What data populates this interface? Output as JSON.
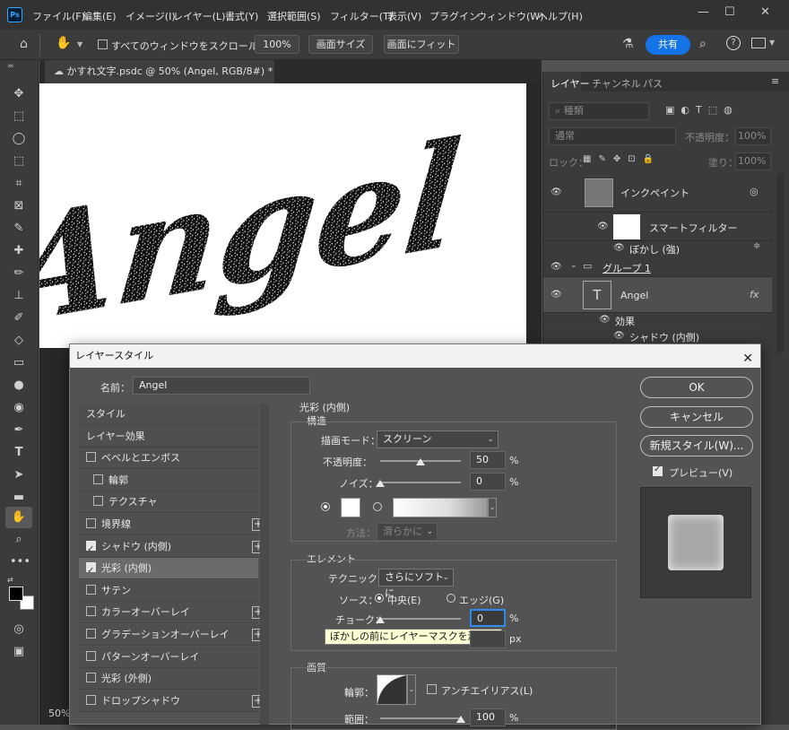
{
  "app": {
    "logo": "Ps",
    "menu": [
      "ファイル(F)",
      "編集(E)",
      "イメージ(I)",
      "レイヤー(L)",
      "書式(Y)",
      "選択範囲(S)",
      "フィルター(T)",
      "表示(V)",
      "プラグイン",
      "ウィンドウ(W)",
      "ヘルプ(H)"
    ]
  },
  "options_bar": {
    "scroll_all_label": "すべてのウィンドウをスクロール",
    "zoom_value": "100%",
    "fit_screen_label": "画面サイズ",
    "fill_screen_label": "画面にフィット",
    "share_label": "共有"
  },
  "document": {
    "tab_title": "かすれ文字.psdc @ 50% (Angel, RGB/8#) *",
    "canvas_text": "Angel",
    "zoom_status": "50%"
  },
  "layers_panel": {
    "tabs": [
      "レイヤー",
      "チャンネル",
      "パス"
    ],
    "filter_placeholder": "種類",
    "blend_mode": "通常",
    "opacity_label": "不透明度：",
    "opacity_value": "100%",
    "lock_label": "ロック：",
    "fill_label": "塗り：",
    "fill_value": "100%",
    "layers": {
      "inpaint": "インクペイント",
      "smart_filter": "スマートフィルター",
      "blur": "ぼかし (強)",
      "group": "グループ 1",
      "angel": "Angel",
      "effects": "効果",
      "inner_shadow": "シャドウ (内側)",
      "text_thumb": "T",
      "fx": "fx"
    }
  },
  "dialog": {
    "title": "レイヤースタイル",
    "name_label": "名前：",
    "name_value": "Angel",
    "styles": [
      {
        "label": "スタイル",
        "checkbox": false,
        "checked": false,
        "plus": false,
        "selected": false
      },
      {
        "label": "レイヤー効果",
        "checkbox": false,
        "checked": false,
        "plus": false,
        "selected": false
      },
      {
        "label": "ベベルとエンボス",
        "checkbox": true,
        "checked": false,
        "plus": false,
        "selected": false
      },
      {
        "label": "輪郭",
        "checkbox": true,
        "checked": false,
        "plus": false,
        "selected": false,
        "indent": true
      },
      {
        "label": "テクスチャ",
        "checkbox": true,
        "checked": false,
        "plus": false,
        "selected": false,
        "indent": true
      },
      {
        "label": "境界線",
        "checkbox": true,
        "checked": false,
        "plus": true,
        "selected": false
      },
      {
        "label": "シャドウ (内側)",
        "checkbox": true,
        "checked": true,
        "plus": true,
        "selected": false
      },
      {
        "label": "光彩 (内側)",
        "checkbox": true,
        "checked": true,
        "plus": false,
        "selected": true
      },
      {
        "label": "サテン",
        "checkbox": true,
        "checked": false,
        "plus": false,
        "selected": false
      },
      {
        "label": "カラーオーバーレイ",
        "checkbox": true,
        "checked": false,
        "plus": true,
        "selected": false
      },
      {
        "label": "グラデーションオーバーレイ",
        "checkbox": true,
        "checked": false,
        "plus": true,
        "selected": false
      },
      {
        "label": "パターンオーバーレイ",
        "checkbox": true,
        "checked": false,
        "plus": false,
        "selected": false
      },
      {
        "label": "光彩 (外側)",
        "checkbox": true,
        "checked": false,
        "plus": false,
        "selected": false
      },
      {
        "label": "ドロップシャドウ",
        "checkbox": true,
        "checked": false,
        "plus": true,
        "selected": false
      }
    ],
    "section_title": "光彩 (内側)",
    "structure": {
      "title": "構造",
      "blend_label": "描画モード：",
      "blend_value": "スクリーン",
      "opacity_label": "不透明度：",
      "opacity_value": "50",
      "opacity_pct": 0.5,
      "noise_label": "ノイズ：",
      "noise_value": "0",
      "noise_pct": 0.0,
      "method_label": "方法：",
      "method_value": "滑らかに",
      "percent": "%"
    },
    "elements": {
      "title": "エレメント",
      "technique_label": "テクニック：",
      "technique_value": "さらにソフトに",
      "source_label": "ソース：",
      "source_center": "中央(E)",
      "source_edge": "エッジ(G)",
      "choke_label": "チョーク：",
      "choke_value": "0",
      "size_unit": "px",
      "tooltip": "ぼかしの前にレイヤーマスクを減らす"
    },
    "quality": {
      "title": "画質",
      "contour_label": "輪郭：",
      "antialias_label": "アンチエイリアス(L)",
      "range_label": "範囲：",
      "range_value": "100",
      "range_pct": 1.0
    },
    "buttons": {
      "ok": "OK",
      "cancel": "キャンセル",
      "new_style": "新規スタイル(W)...",
      "preview": "プレビュー(V)"
    }
  }
}
